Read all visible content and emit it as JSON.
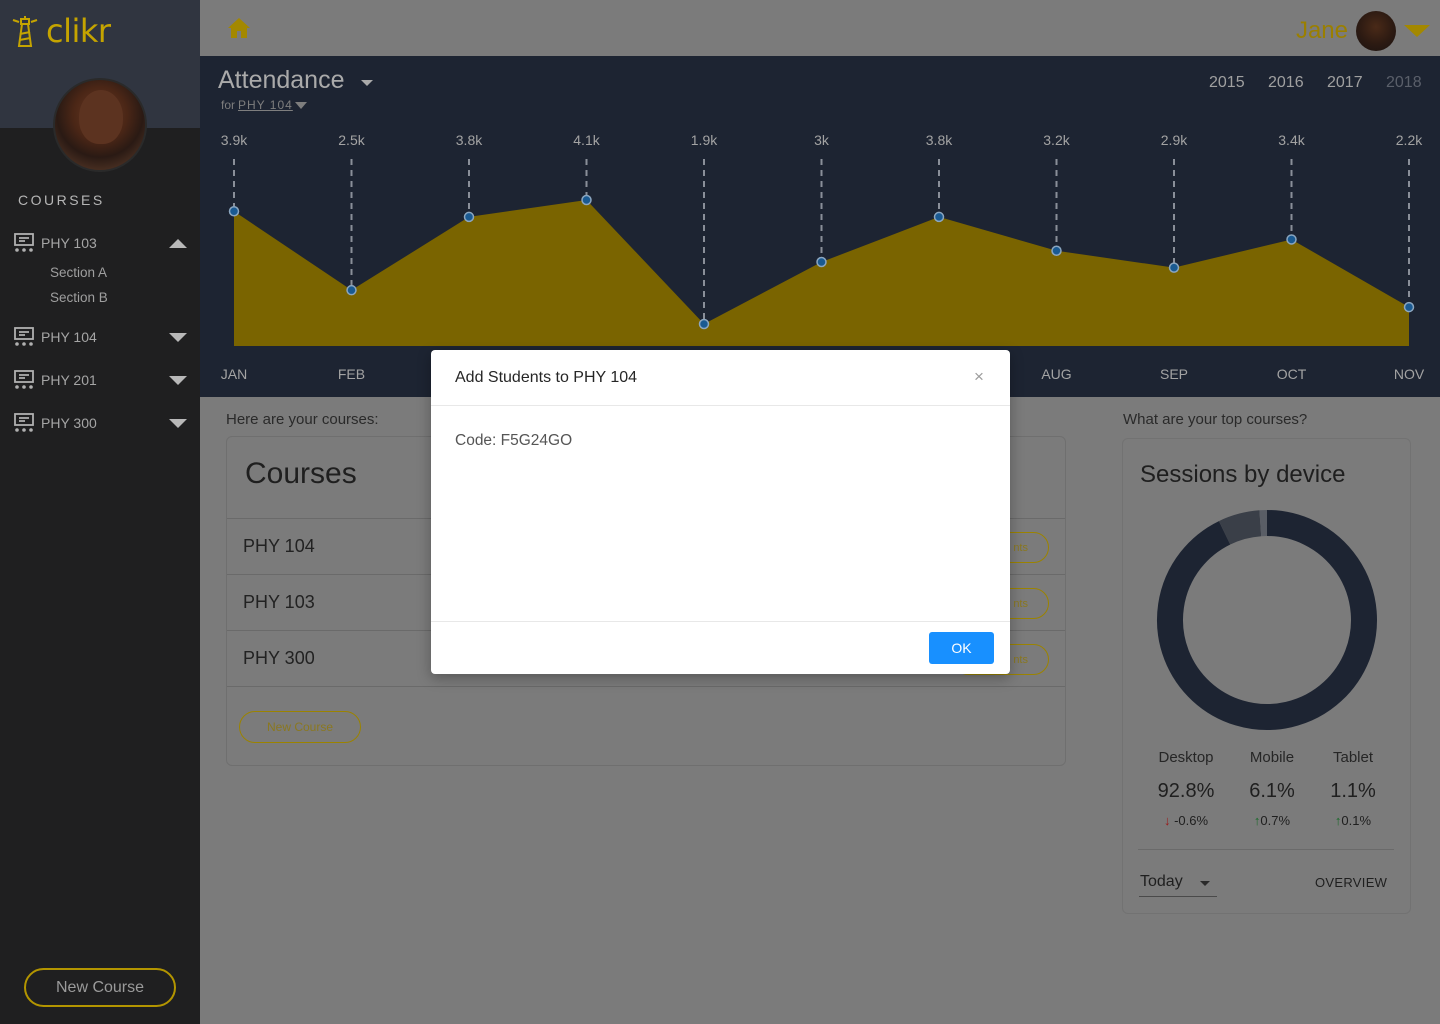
{
  "app": {
    "logo_text": "clikr"
  },
  "sidebar": {
    "heading": "COURSES",
    "items": [
      {
        "label": "PHY 103",
        "expanded": true,
        "sections": [
          "Section A",
          "Section B"
        ]
      },
      {
        "label": "PHY 104",
        "expanded": false
      },
      {
        "label": "PHY 201",
        "expanded": false
      },
      {
        "label": "PHY 300",
        "expanded": false
      }
    ],
    "new_course_label": "New Course"
  },
  "header": {
    "user_name": "Jane"
  },
  "attendance": {
    "title": "Attendance",
    "subtitle_prefix": "for",
    "subtitle_course": "PHY 104",
    "years": [
      "2015",
      "2016",
      "2017",
      "2018"
    ],
    "active_year": "2018"
  },
  "chart_data": {
    "type": "area",
    "title": "Attendance",
    "categories": [
      "JAN",
      "FEB",
      "",
      "",
      "",
      "",
      "",
      "AUG",
      "SEP",
      "OCT",
      "NOV"
    ],
    "value_labels": [
      "3.9k",
      "2.5k",
      "3.8k",
      "4.1k",
      "1.9k",
      "3k",
      "3.8k",
      "3.2k",
      "2.9k",
      "3.4k",
      "2.2k"
    ],
    "values": [
      3900,
      2500,
      3800,
      4100,
      1900,
      3000,
      3800,
      3200,
      2900,
      3400,
      2200
    ],
    "color": "#ffd000",
    "grid": false,
    "legend": "none"
  },
  "courses_section": {
    "label": "Here are your courses:",
    "card_title": "Courses",
    "rows": [
      {
        "name": "PHY 104",
        "button": "nts"
      },
      {
        "name": "PHY 103",
        "button": "nts"
      },
      {
        "name": "PHY 300",
        "button": "nts"
      }
    ],
    "new_course_label": "New Course"
  },
  "devices_section": {
    "label": "What are your top courses?",
    "card_title": "Sessions by device",
    "devices": [
      {
        "name": "Desktop",
        "value": "92.8%",
        "delta": "-0.6%",
        "direction": "down",
        "share": 92.8
      },
      {
        "name": "Mobile",
        "value": "6.1%",
        "delta": "0.7%",
        "direction": "up",
        "share": 6.1
      },
      {
        "name": "Tablet",
        "value": "1.1%",
        "delta": "0.1%",
        "direction": "up",
        "share": 1.1
      }
    ],
    "range_select": "Today",
    "overview_label": "OVERVIEW"
  },
  "modal": {
    "title": "Add Students to PHY 104",
    "close_glyph": "×",
    "body": "Code: F5G24GO",
    "ok_label": "OK"
  },
  "colors": {
    "accent": "#ffd000",
    "sidebar_bg": "#1f1f20",
    "chart_bg": "#1d2432",
    "primary_button": "#1890ff"
  }
}
